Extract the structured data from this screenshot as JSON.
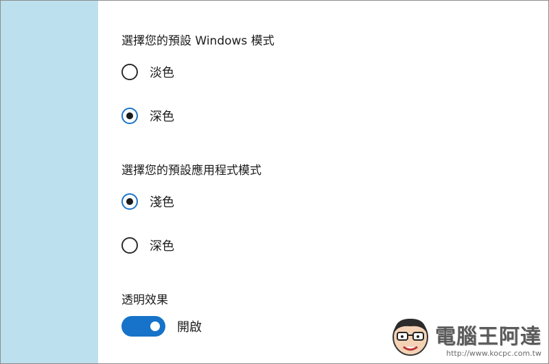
{
  "windows_mode": {
    "heading": "選擇您的預設 Windows 模式",
    "options": [
      {
        "label": "淡色",
        "checked": false
      },
      {
        "label": "深色",
        "checked": true
      }
    ]
  },
  "app_mode": {
    "heading": "選擇您的預設應用程式模式",
    "options": [
      {
        "label": "淺色",
        "checked": true
      },
      {
        "label": "深色",
        "checked": false
      }
    ]
  },
  "transparency": {
    "heading": "透明效果",
    "toggle_state_label": "開啟",
    "on": true
  },
  "watermark": {
    "title": "電腦王阿達",
    "url": "http://www.kocpc.com.tw"
  },
  "colors": {
    "left_panel": "#bde0ef",
    "accent": "#1673c9"
  }
}
